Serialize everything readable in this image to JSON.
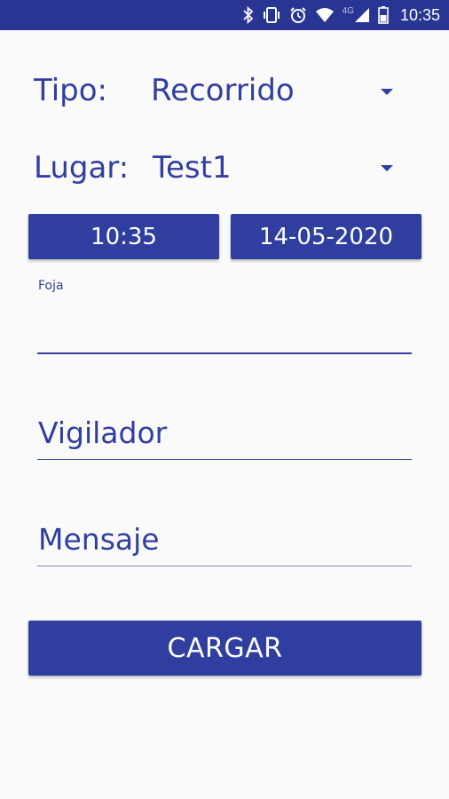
{
  "status_bar": {
    "time": "10:35",
    "network": "4G",
    "icons": [
      "bluetooth-icon",
      "vibrate-icon",
      "alarm-icon",
      "wifi-icon",
      "signal-icon",
      "battery-icon"
    ]
  },
  "form": {
    "tipo": {
      "label": "Tipo:",
      "value": "Recorrido"
    },
    "lugar": {
      "label": "Lugar:",
      "value": "Test1"
    },
    "time_button": "10:35",
    "date_button": "14-05-2020",
    "foja": {
      "label": "Foja",
      "value": ""
    },
    "vigilador": {
      "placeholder": "Vigilador",
      "value": ""
    },
    "mensaje": {
      "placeholder": "Mensaje",
      "value": ""
    },
    "submit_label": "CARGAR"
  },
  "colors": {
    "primary": "#303f9f",
    "status_bar": "#283593",
    "background": "#fafafa"
  }
}
